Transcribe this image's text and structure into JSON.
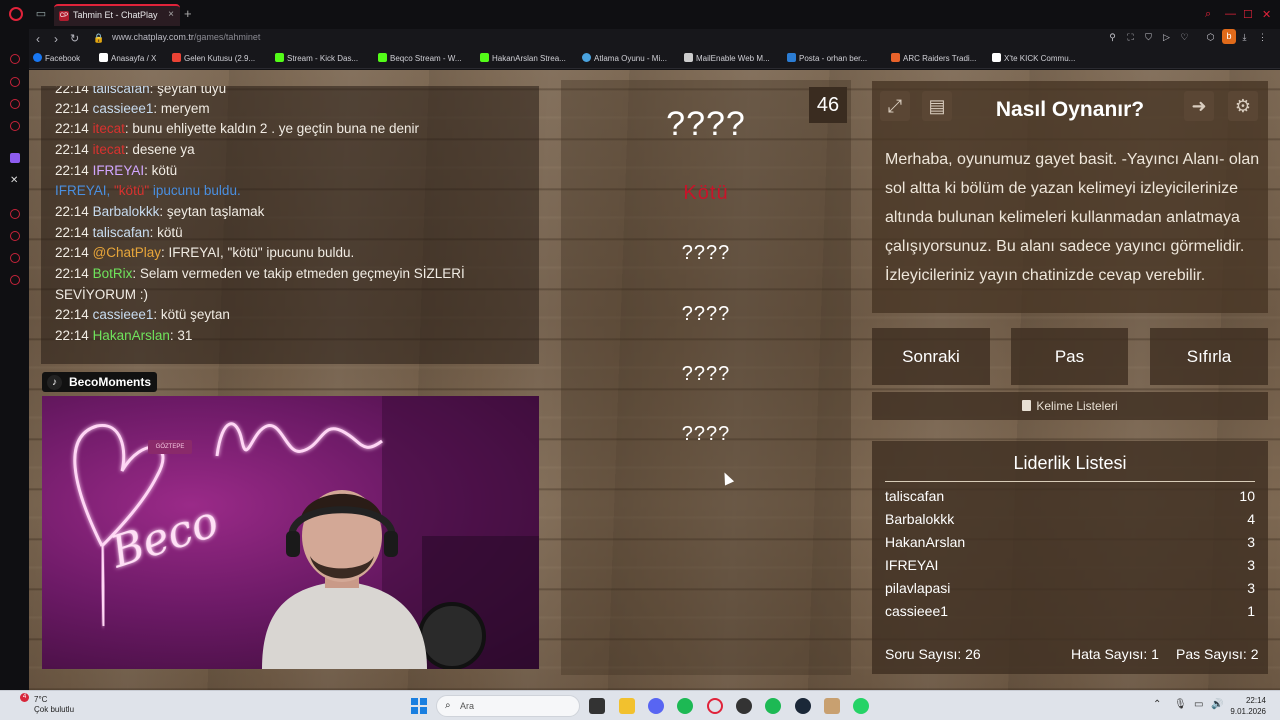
{
  "browser": {
    "tab_title": "Tahmin Et - ChatPlay",
    "tab_favicon": "CP",
    "url_host": "www.chatplay.com.tr",
    "url_path": "/games/tahminet",
    "profile_letter": "b",
    "bookmarks": [
      {
        "label": "Facebook",
        "color": "#1877f2"
      },
      {
        "label": "Anasayfa / X",
        "color": "#ffffff"
      },
      {
        "label": "Gelen Kutusu (2.9...",
        "color": "#ea4335"
      },
      {
        "label": "Stream - Kick Das...",
        "color": "#53fc18"
      },
      {
        "label": "Beqco Stream - W...",
        "color": "#53fc18"
      },
      {
        "label": "HakanArslan Strea...",
        "color": "#53fc18"
      },
      {
        "label": "Atlama Oyunu - Mi...",
        "color": "#4aa3df"
      },
      {
        "label": "MailEnable Web M...",
        "color": "#cccccc"
      },
      {
        "label": "Posta - orhan ber...",
        "color": "#2b7cd3"
      },
      {
        "label": "ARC Raiders Tradi...",
        "color": "#e8622a"
      },
      {
        "label": "X'te KICK Commu...",
        "color": "#ffffff"
      }
    ]
  },
  "chat": {
    "lines": [
      {
        "time": "22:14",
        "user": "taliscafan",
        "msg": ": şeytan tüyü",
        "cls": "blue2"
      },
      {
        "time": "22:14",
        "user": "cassieee1",
        "msg": ": meryem",
        "cls": "blue2"
      },
      {
        "time": "22:14",
        "user": "itecat",
        "msg": ": bunu ehliyette kaldın 2 . ye geçtin buna ne denir",
        "cls": "red"
      },
      {
        "time": "22:14",
        "user": "itecat",
        "msg": ": desene ya",
        "cls": "red"
      },
      {
        "time": "22:14",
        "user": "IFREYAI",
        "msg": ": kötü",
        "cls": "purple"
      },
      {
        "time": "22:14",
        "user": "Barbalokkk",
        "msg": ": şeytan taşlamak",
        "cls": "blue2"
      },
      {
        "time": "22:14",
        "user": "taliscafan",
        "msg": ": kötü",
        "cls": "blue2"
      },
      {
        "time": "22:14",
        "user": "@ChatPlay",
        "msg": ": IFREYAI, \"kötü\" ipucunu buldu.",
        "cls": "orange"
      },
      {
        "time": "22:14",
        "user": "BotRix",
        "msg": ": Selam vermeden ve takip etmeden geçmeyin SİZLERİ",
        "cls": "green"
      },
      {
        "time": "",
        "user": "",
        "msg": "SEVİYORUM :)",
        "cls": ""
      },
      {
        "time": "22:14",
        "user": "cassieee1",
        "msg": ": kötü şeytan",
        "cls": "blue2"
      },
      {
        "time": "22:14",
        "user": "HakanArslan",
        "msg": ": 31",
        "cls": "green"
      }
    ],
    "notice": {
      "user": "IFREYAI, ",
      "word": "\"kötü\"",
      "rest": " ipucunu buldu."
    }
  },
  "webcam": {
    "tag": "BecoMoments",
    "sign": "GÖZTEPE",
    "neon_text": "Beco"
  },
  "game": {
    "timer": "46",
    "secret_word": "????",
    "hint_found": "Kötü",
    "hints": [
      "????",
      "????",
      "????",
      "????"
    ]
  },
  "howto": {
    "title": "Nasıl Oynanır?",
    "text": "Merhaba, oyunumuz gayet basit. -Yayıncı Alanı- olan sol altta ki bölüm de yazan kelimeyi izleyicilerinize altında bulunan kelimeleri kullanmadan anlatmaya çalışıyorsunuz. Bu alanı sadece yayıncı görmelidir. İzleyicileriniz yayın chatinizde cevap verebilir."
  },
  "controls": {
    "next": "Sonraki",
    "pass": "Pas",
    "reset": "Sıfırla",
    "word_lists": "Kelime Listeleri"
  },
  "leaderboard": {
    "title": "Liderlik Listesi",
    "rows": [
      {
        "name": "taliscafan",
        "score": "10"
      },
      {
        "name": "Barbalokkk",
        "score": "4"
      },
      {
        "name": "HakanArslan",
        "score": "3"
      },
      {
        "name": "IFREYAI",
        "score": "3"
      },
      {
        "name": "pilavlapasi",
        "score": "3"
      },
      {
        "name": "cassieee1",
        "score": "1"
      }
    ],
    "question_count": "Soru Sayısı: 26",
    "error_count": "Hata Sayısı: 1",
    "pass_count": "Pas Sayısı: 2"
  },
  "taskbar": {
    "temp": "7°C",
    "weather": "Çok bulutlu",
    "badge": "4",
    "search": "Ara",
    "time": "22:14",
    "date": "9.01.2026"
  }
}
